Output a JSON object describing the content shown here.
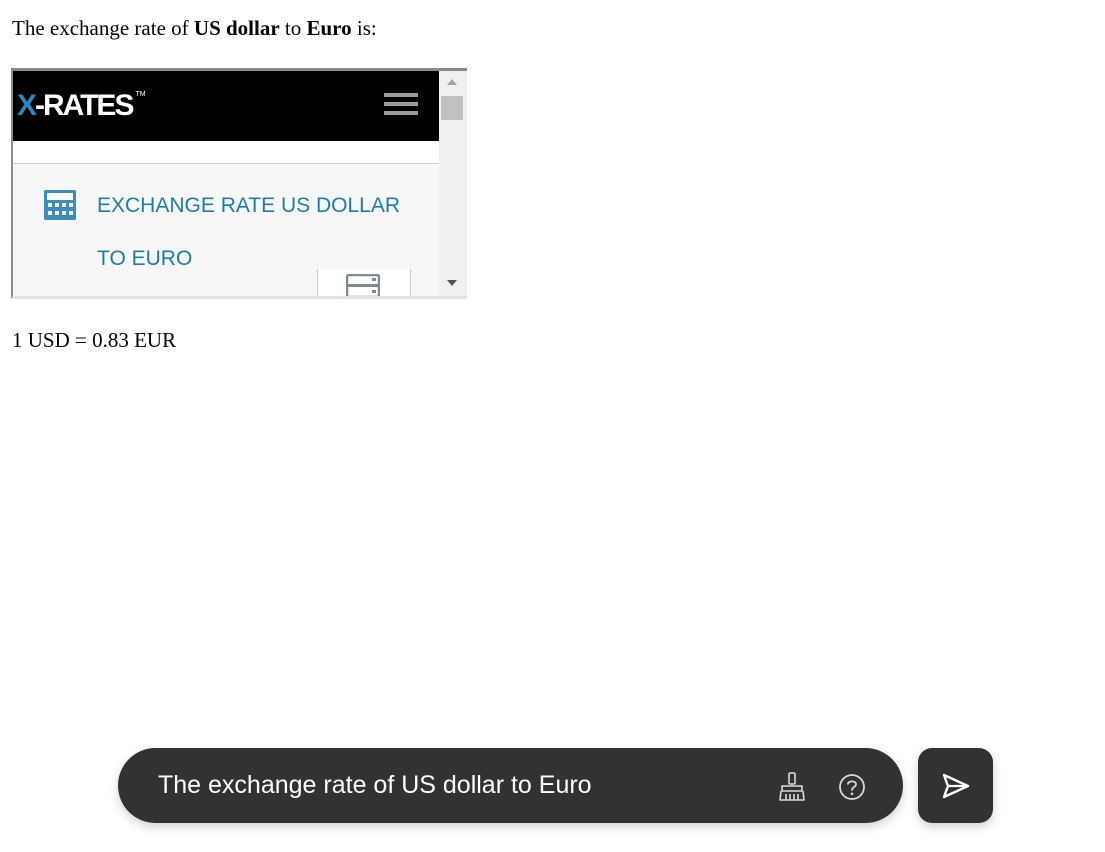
{
  "intro": {
    "prefix": "The exchange rate of ",
    "from_currency": "US dollar",
    "middle": " to ",
    "to_currency": "Euro",
    "suffix": " is:"
  },
  "widget": {
    "logo_x": "X",
    "logo_rest": "-RATES",
    "logo_tm": "TM",
    "title_line1": "EXCHANGE RATE US DOLLAR",
    "title_line2": "TO EURO",
    "icons": {
      "menu": "hamburger-menu-icon",
      "calculator": "calculator-icon",
      "bottom": "calculator-small-icon"
    },
    "colors": {
      "header_bg": "#000000",
      "logo_x": "#2e86c1",
      "title_text": "#1a7fa8"
    }
  },
  "result": {
    "text": "1 USD = 0.83 EUR"
  },
  "input_bar": {
    "value": "The exchange rate of US dollar to Euro",
    "icons": {
      "clear": "broom-icon",
      "help": "help-icon",
      "send": "send-icon"
    },
    "colors": {
      "background": "#323232",
      "text": "#ffffff"
    }
  }
}
